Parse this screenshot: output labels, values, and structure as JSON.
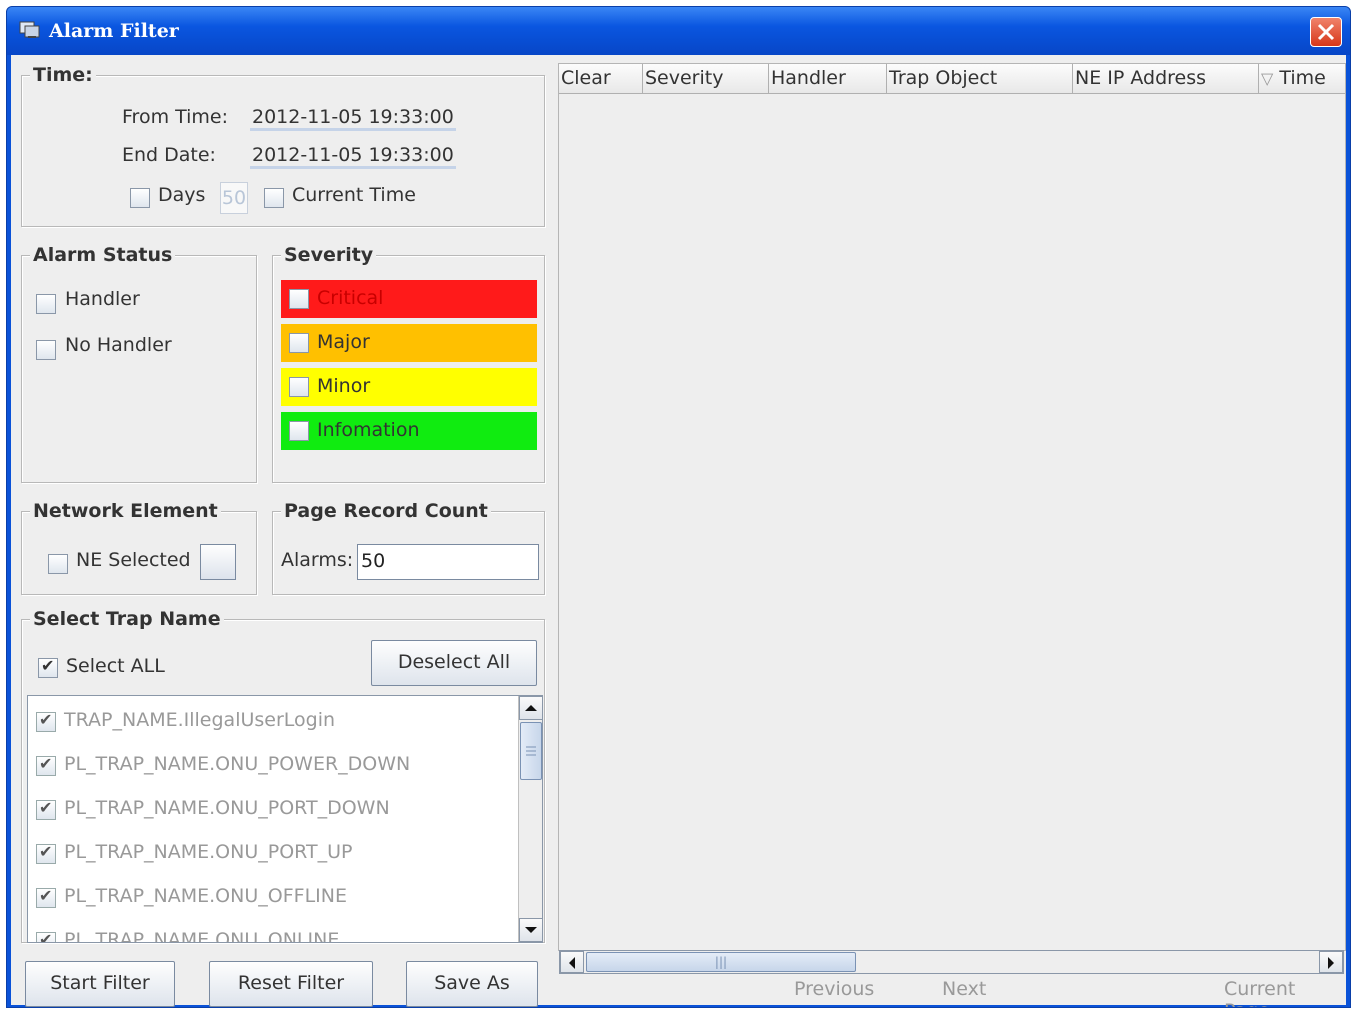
{
  "window": {
    "title": "Alarm Filter"
  },
  "time": {
    "legend": "Time:",
    "from_label": "From Time:",
    "from_value": "2012-11-05 19:33:00",
    "end_label": "End Date:",
    "end_value": "2012-11-05 19:33:00",
    "days_label": "Days",
    "days_value": "50",
    "current_time_label": "Current Time"
  },
  "alarm_status": {
    "legend": "Alarm Status",
    "options": [
      "Handler",
      "No Handler"
    ]
  },
  "severity": {
    "legend": "Severity",
    "options": [
      {
        "label": "Critical",
        "bg": "#ff1a1a",
        "color": "#c80000"
      },
      {
        "label": "Major",
        "bg": "#ffc000",
        "color": "#333333"
      },
      {
        "label": "Minor",
        "bg": "#ffff00",
        "color": "#333333"
      },
      {
        "label": "Infomation",
        "bg": "#10ec10",
        "color": "#333333"
      }
    ]
  },
  "network_element": {
    "legend": "Network Element",
    "ne_selected_label": "NE Selected"
  },
  "page_record": {
    "legend": "Page Record Count",
    "alarms_label": "Alarms:",
    "alarms_value": "50"
  },
  "trap": {
    "legend": "Select Trap Name",
    "select_all_label": "Select ALL",
    "deselect_all_label": "Deselect All",
    "items": [
      "TRAP_NAME.IllegalUserLogin",
      "PL_TRAP_NAME.ONU_POWER_DOWN",
      "PL_TRAP_NAME.ONU_PORT_DOWN",
      "PL_TRAP_NAME.ONU_PORT_UP",
      "PL_TRAP_NAME.ONU_OFFLINE",
      "PL_TRAP_NAME.ONU_ONLINE"
    ]
  },
  "buttons": {
    "start": "Start Filter",
    "reset": "Reset Filter",
    "save": "Save As"
  },
  "table": {
    "columns": [
      "Clear",
      "Severity",
      "Handler",
      "Trap Object",
      "NE IP Address",
      "Time"
    ],
    "sort_indicator": "▽"
  },
  "pager": {
    "previous": "Previous",
    "next": "Next",
    "current": "Current Page"
  }
}
